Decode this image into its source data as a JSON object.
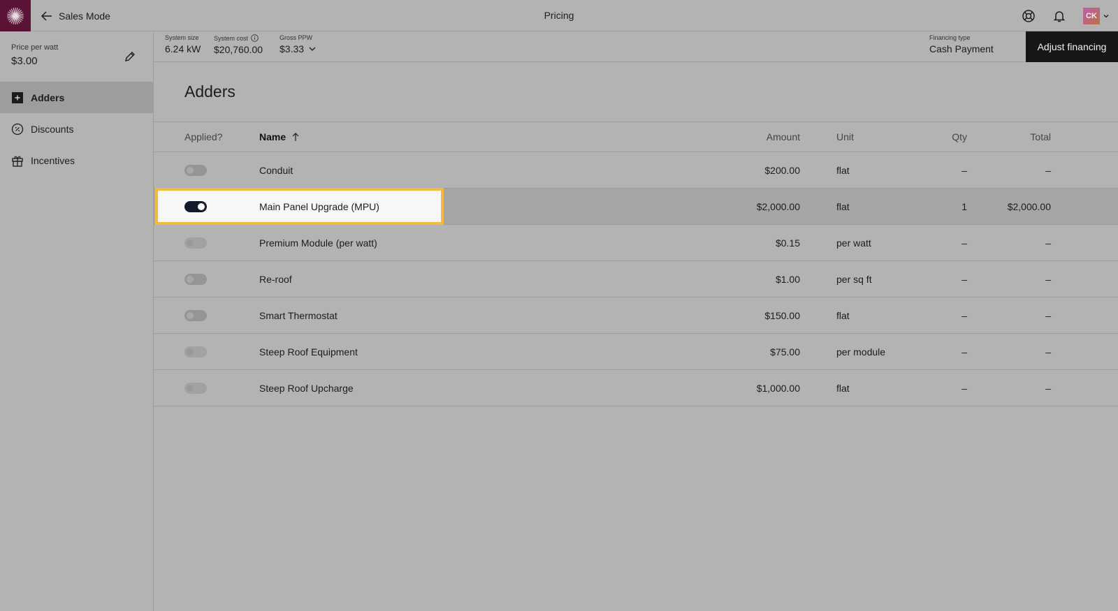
{
  "header": {
    "back_label": "Sales Mode",
    "title": "Pricing",
    "avatar_initials": "CK",
    "logo_color": "#5a1236"
  },
  "sidebar": {
    "price_per_watt_label": "Price per watt",
    "price_per_watt_value": "$3.00",
    "items": [
      {
        "label": "Adders",
        "icon": "plus-square-icon",
        "active": true
      },
      {
        "label": "Discounts",
        "icon": "discount-icon",
        "active": false
      },
      {
        "label": "Incentives",
        "icon": "gift-icon",
        "active": false
      }
    ]
  },
  "summary": {
    "system_size_label": "System size",
    "system_size_value": "6.24 kW",
    "system_cost_label": "System cost",
    "system_cost_value": "$20,760.00",
    "gross_ppw_label": "Gross PPW",
    "gross_ppw_value": "$3.33",
    "financing_type_label": "Financing type",
    "financing_type_value": "Cash Payment",
    "adjust_button": "Adjust financing"
  },
  "adders": {
    "title": "Adders",
    "columns": {
      "applied": "Applied?",
      "name": "Name",
      "amount": "Amount",
      "unit": "Unit",
      "qty": "Qty",
      "total": "Total"
    },
    "rows": [
      {
        "applied": false,
        "name": "Conduit",
        "amount": "$200.00",
        "unit": "flat",
        "qty": "–",
        "total": "–"
      },
      {
        "applied": true,
        "name": "Main Panel Upgrade (MPU)",
        "amount": "$2,000.00",
        "unit": "flat",
        "qty": "1",
        "total": "$2,000.00"
      },
      {
        "applied": false,
        "name": "Premium Module (per watt)",
        "amount": "$0.15",
        "unit": "per watt",
        "qty": "–",
        "total": "–"
      },
      {
        "applied": false,
        "name": "Re-roof",
        "amount": "$1.00",
        "unit": "per sq ft",
        "qty": "–",
        "total": "–"
      },
      {
        "applied": false,
        "name": "Smart Thermostat",
        "amount": "$150.00",
        "unit": "flat",
        "qty": "–",
        "total": "–"
      },
      {
        "applied": false,
        "name": "Steep Roof Equipment",
        "amount": "$75.00",
        "unit": "per module",
        "qty": "–",
        "total": "–"
      },
      {
        "applied": false,
        "name": "Steep Roof Upcharge",
        "amount": "$1,000.00",
        "unit": "flat",
        "qty": "–",
        "total": "–"
      }
    ]
  }
}
